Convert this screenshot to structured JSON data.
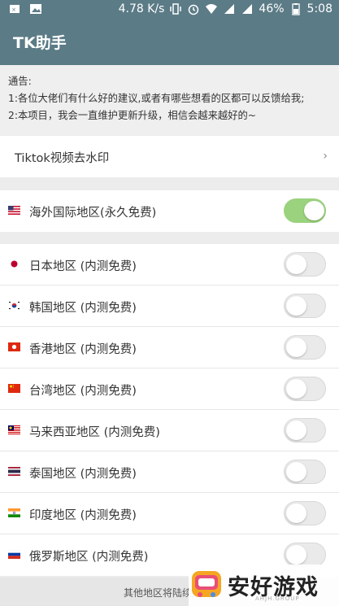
{
  "status_bar": {
    "speed": "4.78 K/s",
    "battery": "46%",
    "time": "5:08",
    "icons": [
      "sim-icon",
      "image-icon",
      "vibrate-icon",
      "alarm-icon",
      "wifi-icon",
      "signal-icon",
      "signal-icon",
      "battery-icon"
    ]
  },
  "app_bar": {
    "title": "TK助手"
  },
  "notice": {
    "line1": "通告:",
    "line2": "1:各位大佬们有什么好的建议,或者有哪些想看的区都可以反馈给我;",
    "line3": "2:本项目，我会一直维护更新升级，相信会越来越好的~"
  },
  "link_row": {
    "label": "Tiktok视频去水印",
    "chevron": "›"
  },
  "overseas": {
    "label": "海外国际地区(永久免费)",
    "enabled": true
  },
  "regions": [
    {
      "label": "日本地区 (内测免费)",
      "flag": "japan-flag-icon",
      "enabled": false
    },
    {
      "label": "韩国地区 (内测免费)",
      "flag": "korea-flag-icon",
      "enabled": false
    },
    {
      "label": "香港地区 (内测免费)",
      "flag": "hongkong-flag-icon",
      "enabled": false
    },
    {
      "label": "台湾地区 (内测免费)",
      "flag": "china-flag-icon",
      "enabled": false
    },
    {
      "label": "马来西亚地区 (内测免费)",
      "flag": "malaysia-flag-icon",
      "enabled": false
    },
    {
      "label": "泰国地区 (内测免费)",
      "flag": "thailand-flag-icon",
      "enabled": false
    },
    {
      "label": "印度地区 (内测免费)",
      "flag": "india-flag-icon",
      "enabled": false
    },
    {
      "label": "俄罗斯地区 (内测免费)",
      "flag": "russia-flag-icon",
      "enabled": false
    }
  ],
  "footer": {
    "text": "其他地区将陆续开放"
  },
  "watermark": {
    "title": "安好游戏",
    "sub": "AHJH.GROUP"
  },
  "colors": {
    "app_bar": "#5b7b86",
    "toggle_on": "#9bd27e"
  }
}
